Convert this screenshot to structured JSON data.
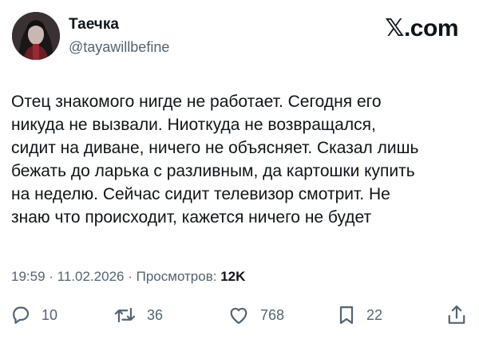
{
  "author": {
    "display_name": "Таечка",
    "handle": "@tayawillbefine"
  },
  "brand": {
    "label": ".com",
    "icon": "x-logo-icon"
  },
  "tweet": {
    "lines": [
      "Отец знакомого нигде не работает. Сегодня его",
      "никуда не вызвали. Ниоткуда не возвращался,",
      "сидит на диване, ничего не объясняет. Сказал лишь",
      "бежать до ларька с разливным, да картошки купить",
      "на неделю. Сейчас сидит телевизор смотрит. Не",
      "знаю что происходит, кажется ничего не будет"
    ]
  },
  "meta": {
    "time": "19:59",
    "date": "11.02.2026",
    "views_label": "Просмотров:",
    "views_count": "12K"
  },
  "actions": {
    "reply": {
      "icon": "reply-icon",
      "count": "10"
    },
    "retweet": {
      "icon": "retweet-icon",
      "count": "36"
    },
    "like": {
      "icon": "heart-icon",
      "count": "768"
    },
    "bookmark": {
      "icon": "bookmark-icon",
      "count": "22"
    },
    "share": {
      "icon": "share-icon"
    }
  },
  "colors": {
    "text": "#0f1419",
    "secondary": "#536471",
    "background": "#ffffff"
  }
}
